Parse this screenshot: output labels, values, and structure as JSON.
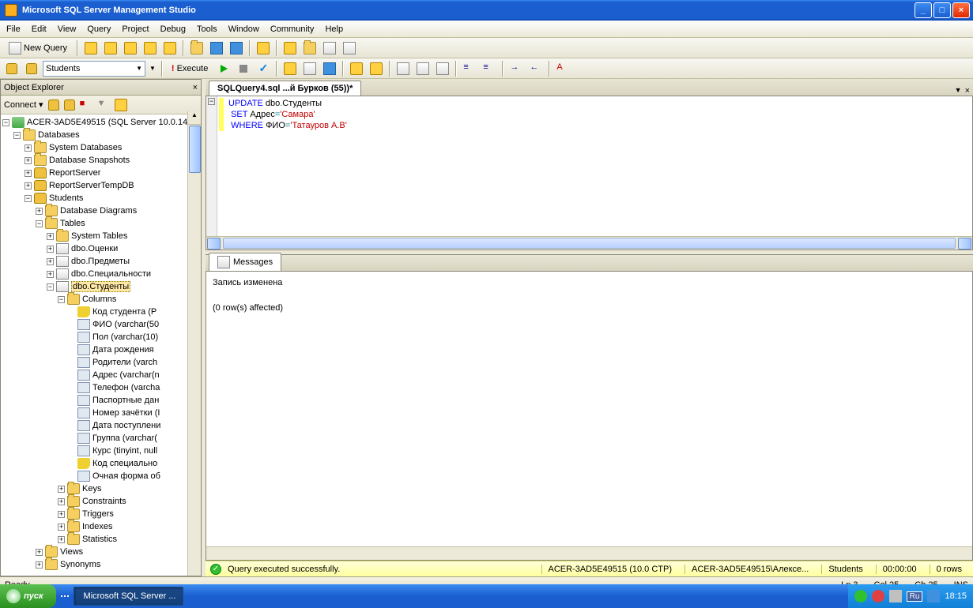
{
  "title": "Microsoft SQL Server Management Studio",
  "menus": [
    "File",
    "Edit",
    "View",
    "Query",
    "Project",
    "Debug",
    "Tools",
    "Window",
    "Community",
    "Help"
  ],
  "toolbar": {
    "new_query": "New Query"
  },
  "sql_toolbar": {
    "db": "Students",
    "execute": "Execute"
  },
  "objexp": {
    "title": "Object Explorer",
    "connect": "Connect",
    "server": "ACER-3AD5E49515 (SQL Server 10.0.14",
    "databases": "Databases",
    "sysdb": "System Databases",
    "snapshots": "Database Snapshots",
    "rs": "ReportServer",
    "rstemp": "ReportServerTempDB",
    "students": "Students",
    "diagrams": "Database Diagrams",
    "tables": "Tables",
    "systables": "System Tables",
    "t1": "dbo.Оценки",
    "t2": "dbo.Предметы",
    "t3": "dbo.Специальности",
    "t4": "dbo.Студенты",
    "columns": "Columns",
    "c1": "Код студента (P",
    "c2": "ФИО (varchar(50",
    "c3": "Пол (varchar(10)",
    "c4": "Дата рождения",
    "c5": "Родители (varch",
    "c6": "Адрес (varchar(n",
    "c7": "Телефон (varcha",
    "c8": "Паспортные дан",
    "c9": "Номер зачётки (I",
    "c10": "Дата поступлени",
    "c11": "Группа (varchar(",
    "c12": "Курс (tinyint, null",
    "c13": "Код специально",
    "c14": "Очная форма об",
    "keys": "Keys",
    "constraints": "Constraints",
    "triggers": "Triggers",
    "indexes": "Indexes",
    "statistics": "Statistics",
    "views": "Views",
    "synonyms": "Synonyms"
  },
  "doc": {
    "tab": "SQLQuery4.sql ...й Бурков (55))*"
  },
  "sql": {
    "l1a": "UPDATE",
    "l1b": " dbo",
    "l1c": ".",
    "l1d": "Студенты",
    "l2a": "SET",
    "l2b": " Адрес",
    "l2c": "=",
    "l2d": "'Самара'",
    "l3a": "WHERE",
    "l3b": " ФИО",
    "l3c": "=",
    "l3d": "'Татауров А.В'"
  },
  "messages": {
    "tab": "Messages",
    "l1": "Запись изменена",
    "l2": "(0 row(s) affected)"
  },
  "qstatus": {
    "msg": "Query executed successfully.",
    "server": "ACER-3AD5E49515 (10.0 CTP)",
    "user": "ACER-3AD5E49515\\Алексе...",
    "db": "Students",
    "time": "00:00:00",
    "rows": "0 rows"
  },
  "statusbar": {
    "ready": "Ready",
    "ln": "Ln 3",
    "col": "Col 25",
    "ch": "Ch 25",
    "ins": "INS"
  },
  "taskbar": {
    "start": "пуск",
    "task1": "Microsoft SQL Server ...",
    "lang": "Ru",
    "time": "18:15"
  }
}
